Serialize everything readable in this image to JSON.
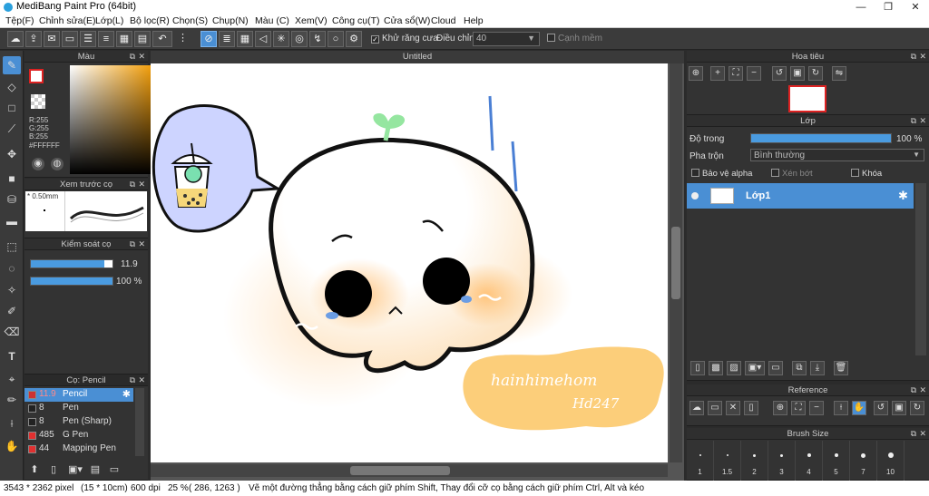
{
  "window": {
    "title": "MediBang Paint Pro (64bit)",
    "minimize": "—",
    "maximize": "❐",
    "close": "✕"
  },
  "menu": [
    "Tệp(F)",
    "Chỉnh sửa(E)",
    "Lớp(L)",
    "Bộ lọc(R)",
    "Chọn(S)",
    "Chụp(N)",
    "Màu (C)",
    "Xem(V)",
    "Công cụ(T)",
    "Cửa sổ(W)",
    "Cloud",
    "Help"
  ],
  "toolbar": {
    "antialias_label": "Khử răng cưa",
    "adjust_label": "Điều chỉnh",
    "adjust_value": "40",
    "sharp_edge_label": "Cạnh mềm"
  },
  "color_panel": {
    "title": "Màu",
    "r": "R:255",
    "g": "G:255",
    "b": "B:255",
    "hex": "#FFFFFF"
  },
  "preview_panel": {
    "title": "Xem trước cọ",
    "size": "0.50mm"
  },
  "control_panel": {
    "title": "Kiểm soát cọ",
    "size_value": "11.9",
    "size_fraction": 0.9,
    "opacity_value": "100 %",
    "opacity_fraction": 1.0
  },
  "brush_list": {
    "title": "Cọ: Pencil",
    "items": [
      {
        "size": "11.9",
        "name": "Pencil",
        "color": "#cc3333",
        "selected": true
      },
      {
        "size": "8",
        "name": "Pen",
        "color": "#222222",
        "selected": false
      },
      {
        "size": "8",
        "name": "Pen (Sharp)",
        "color": "#222222",
        "selected": false
      },
      {
        "size": "485",
        "name": "G Pen",
        "color": "#e03030",
        "selected": false
      },
      {
        "size": "44",
        "name": "Mapping Pen",
        "color": "#e03030",
        "selected": false
      }
    ]
  },
  "canvas": {
    "tab_title": "Untitled",
    "signature_text": "hainhimehom",
    "signature_sub": "Hd247"
  },
  "navigator": {
    "title": "Hoa tiêu"
  },
  "layer_panel": {
    "title": "Lớp",
    "opacity_label": "Độ trong",
    "opacity_value": "100 %",
    "opacity_fraction": 1.0,
    "blend_label": "Pha trộn",
    "blend_value": "Bình thường",
    "protect_alpha": "Bảo vệ alpha",
    "clipping": "Xén bớt",
    "lock": "Khóa",
    "layers": [
      {
        "name": "Lớp1"
      }
    ]
  },
  "reference_panel": {
    "title": "Reference"
  },
  "brush_size_panel": {
    "title": "Brush Size",
    "sizes": [
      "1",
      "1.5",
      "2",
      "3",
      "4",
      "5",
      "7",
      "10"
    ]
  },
  "status": {
    "dimensions": "3543 * 2362 pixel",
    "physical": "(15 * 10cm)",
    "dpi": "600 dpi",
    "zoom": "25 %",
    "cursor": "( 286, 1263 )",
    "hint": "Vẽ một đường thẳng bằng cách giữ phím Shift, Thay đổi cỡ cọ bằng cách giữ phím Ctrl, Alt và kéo"
  }
}
